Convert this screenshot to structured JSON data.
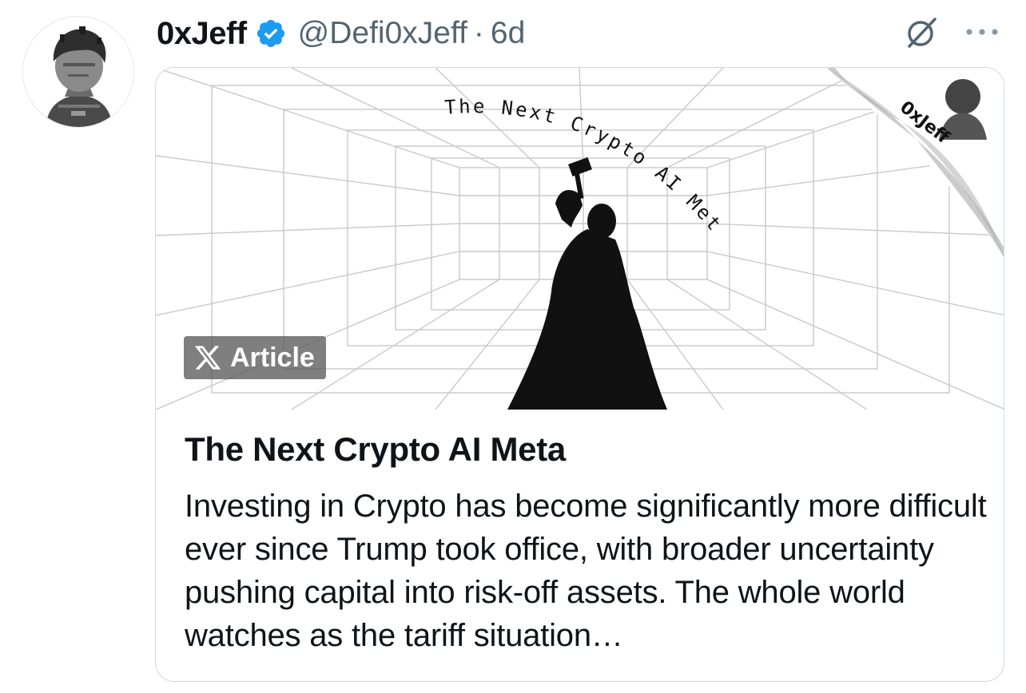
{
  "tweet": {
    "author_name": "0xJeff",
    "handle": "@Defi0xJeff",
    "separator": "·",
    "time": "6d"
  },
  "card": {
    "badge_label": "Article",
    "image_banner_text": "The Next Crypto AI Meta",
    "image_corner_text": "0xJeff",
    "title": "The Next Crypto AI Meta",
    "description": "Investing in Crypto has become significantly more difficult ever since Trump took office, with broader uncertainty pushing capital into risk-off assets. The whole world watches as the tariff situation…"
  },
  "icons": {
    "avatar": "avatar",
    "verified": "verified-badge-icon",
    "grok": "grok-icon",
    "more": "more-icon",
    "x_logo": "x-logo-icon"
  },
  "colors": {
    "verified_blue": "#1d9bf0",
    "secondary_text": "#536471",
    "card_border": "#cfd9de",
    "badge_bg": "#5b5b5b"
  }
}
